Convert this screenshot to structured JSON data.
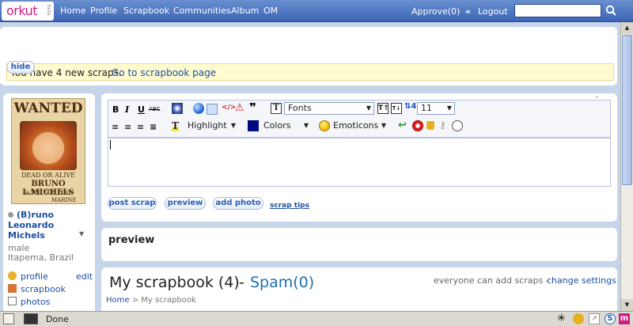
{
  "topbar": {
    "logo": "orkut",
    "logo_badge": "beta",
    "nav": [
      "Home",
      "Profile",
      "Scrapbook",
      "Communities",
      "Album",
      "OM"
    ],
    "approve": "Approve(0)",
    "collapse_glyph": "«",
    "logout": "Logout",
    "search_placeholder": ""
  },
  "notice": {
    "text": "You have 4 new scraps.",
    "link": "Go to scrapbook page",
    "hide_label": "hide"
  },
  "profile": {
    "poster_title": "WANTED",
    "poster_line1": "DEAD OR ALIVE",
    "poster_line2": "BRUNO L.MICHELS",
    "poster_line3": "☠300.000.000-",
    "poster_line4": "MARINE",
    "name": "(B)runo Leonardo Michels",
    "gender": "male",
    "location": "Itapema, Brazil",
    "links": [
      {
        "label": "profile",
        "icon": "profile-icon"
      },
      {
        "label": "scrapbook",
        "icon": "scrapbook-icon"
      },
      {
        "label": "photos",
        "icon": "photos-icon"
      }
    ],
    "edit": "edit"
  },
  "editor": {
    "bold": "B",
    "italic": "I",
    "underline": "U",
    "strike": "ABC",
    "fonts": "Fonts",
    "size": "11",
    "highlight": "Highlight",
    "colors": "Colors",
    "emoticons": "Emoticons",
    "post_label": "post scrap",
    "preview_label": "preview",
    "photo_label": "add photo",
    "tips_label": "scrap tips"
  },
  "preview_panel": {
    "title": "preview"
  },
  "scrapbook": {
    "title": "My scrapbook (4)",
    "separator": "-",
    "spam": "Spam(0)",
    "policy": "everyone can add scraps -",
    "change": "change settings",
    "crumb_home": "Home",
    "crumb_sep": ">",
    "crumb_current": "My scrapbook"
  },
  "statusbar": {
    "text": "Done"
  },
  "colors": {
    "topbar": "#3c64b4",
    "link": "#1d4fa0",
    "notice_bg": "#fffbd0",
    "page_bg": "#c6d5ea"
  }
}
